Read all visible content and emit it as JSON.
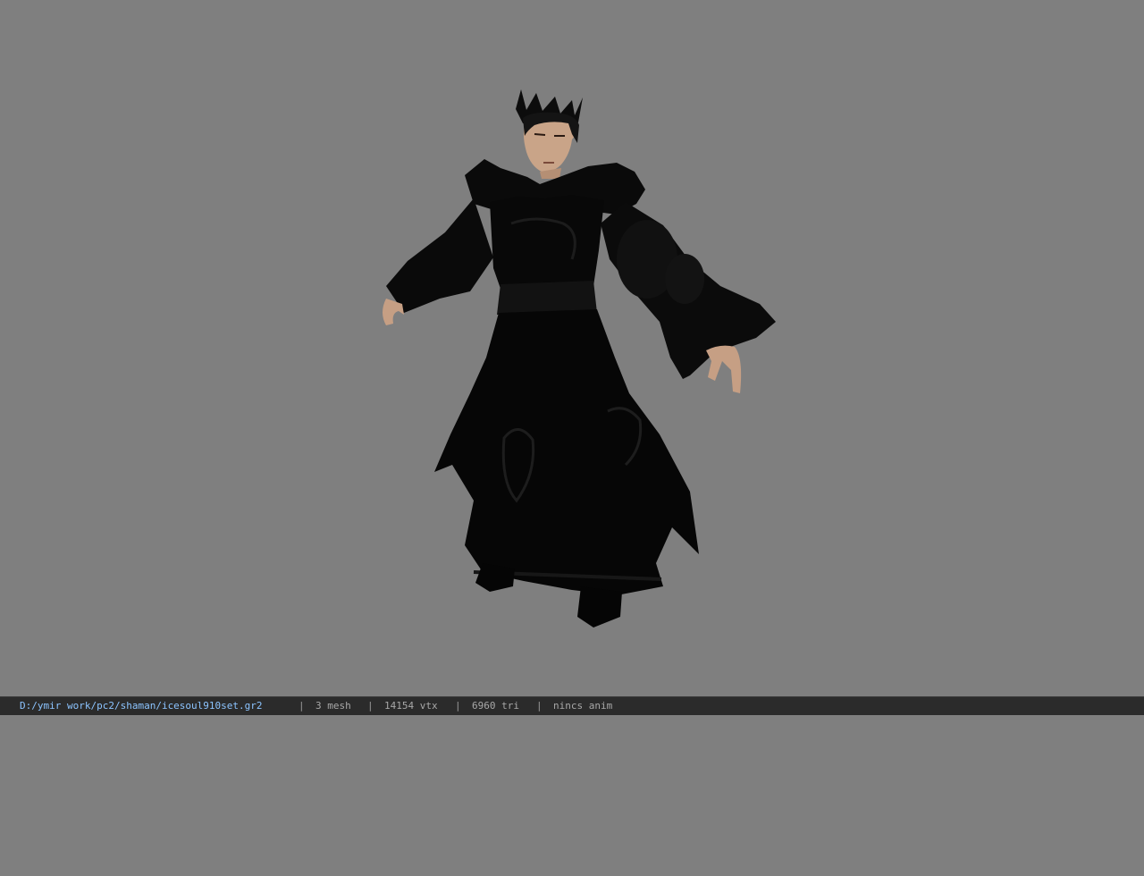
{
  "viewer": {
    "background_color": "#7f7f7f",
    "model_subject": "3D character in black robe with dark crown, T-pose"
  },
  "status_bar": {
    "file_path": "D:/ymir work/pc2/shaman/icesoul910set.gr2",
    "separator": "|",
    "mesh": "3 mesh",
    "vtx": "14154 vtx",
    "tri": "6960 tri",
    "anim": "nincs anim",
    "path_color": "#8cc4ff",
    "text_color": "#a8a8a8"
  }
}
